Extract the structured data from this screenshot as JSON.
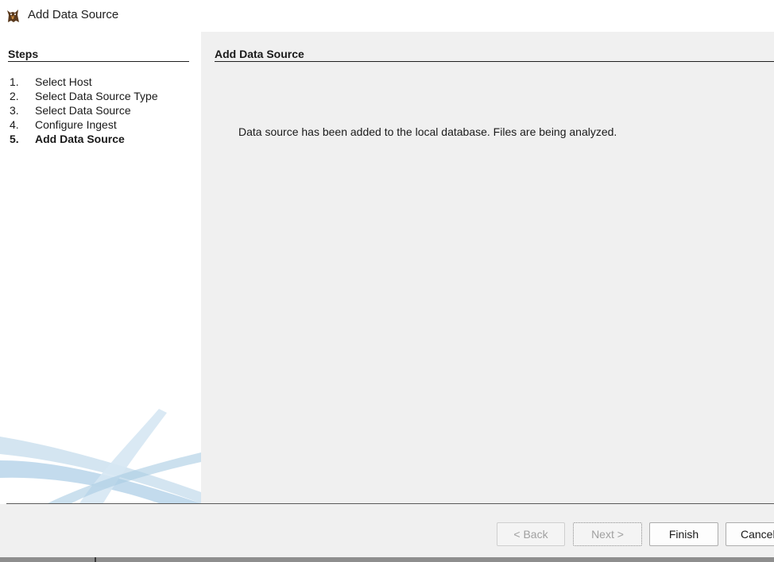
{
  "window": {
    "title": "Add Data Source",
    "icon": "autopsy-dog-icon"
  },
  "steps": {
    "heading": "Steps",
    "items": [
      {
        "num": "1.",
        "label": "Select Host"
      },
      {
        "num": "2.",
        "label": "Select Data Source Type"
      },
      {
        "num": "3.",
        "label": "Select Data Source"
      },
      {
        "num": "4.",
        "label": "Configure Ingest"
      },
      {
        "num": "5.",
        "label": "Add Data Source"
      }
    ],
    "active_index": 4
  },
  "panel": {
    "title": "Add Data Source",
    "message": "Data source has been added to the local database. Files are being analyzed."
  },
  "buttons": {
    "back": "< Back",
    "next": "Next >",
    "finish": "Finish",
    "cancel": "Cancel"
  },
  "colors": {
    "panel_bg": "#f0f0f0",
    "swoosh": "#a9cbe3"
  }
}
